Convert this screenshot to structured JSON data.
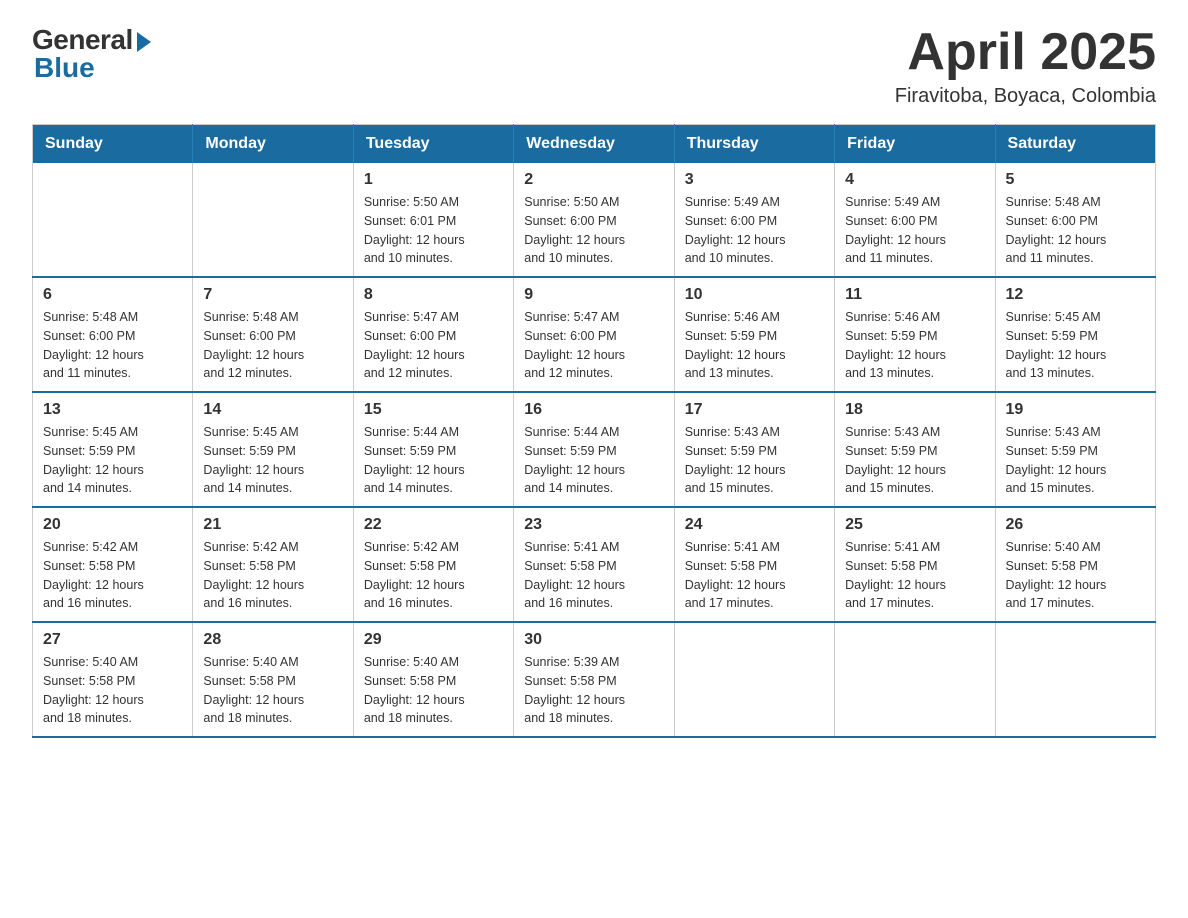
{
  "logo": {
    "general": "General",
    "blue": "Blue"
  },
  "title": {
    "month_year": "April 2025",
    "location": "Firavitoba, Boyaca, Colombia"
  },
  "headers": [
    "Sunday",
    "Monday",
    "Tuesday",
    "Wednesday",
    "Thursday",
    "Friday",
    "Saturday"
  ],
  "weeks": [
    [
      {
        "day": "",
        "info": ""
      },
      {
        "day": "",
        "info": ""
      },
      {
        "day": "1",
        "info": "Sunrise: 5:50 AM\nSunset: 6:01 PM\nDaylight: 12 hours\nand 10 minutes."
      },
      {
        "day": "2",
        "info": "Sunrise: 5:50 AM\nSunset: 6:00 PM\nDaylight: 12 hours\nand 10 minutes."
      },
      {
        "day": "3",
        "info": "Sunrise: 5:49 AM\nSunset: 6:00 PM\nDaylight: 12 hours\nand 10 minutes."
      },
      {
        "day": "4",
        "info": "Sunrise: 5:49 AM\nSunset: 6:00 PM\nDaylight: 12 hours\nand 11 minutes."
      },
      {
        "day": "5",
        "info": "Sunrise: 5:48 AM\nSunset: 6:00 PM\nDaylight: 12 hours\nand 11 minutes."
      }
    ],
    [
      {
        "day": "6",
        "info": "Sunrise: 5:48 AM\nSunset: 6:00 PM\nDaylight: 12 hours\nand 11 minutes."
      },
      {
        "day": "7",
        "info": "Sunrise: 5:48 AM\nSunset: 6:00 PM\nDaylight: 12 hours\nand 12 minutes."
      },
      {
        "day": "8",
        "info": "Sunrise: 5:47 AM\nSunset: 6:00 PM\nDaylight: 12 hours\nand 12 minutes."
      },
      {
        "day": "9",
        "info": "Sunrise: 5:47 AM\nSunset: 6:00 PM\nDaylight: 12 hours\nand 12 minutes."
      },
      {
        "day": "10",
        "info": "Sunrise: 5:46 AM\nSunset: 5:59 PM\nDaylight: 12 hours\nand 13 minutes."
      },
      {
        "day": "11",
        "info": "Sunrise: 5:46 AM\nSunset: 5:59 PM\nDaylight: 12 hours\nand 13 minutes."
      },
      {
        "day": "12",
        "info": "Sunrise: 5:45 AM\nSunset: 5:59 PM\nDaylight: 12 hours\nand 13 minutes."
      }
    ],
    [
      {
        "day": "13",
        "info": "Sunrise: 5:45 AM\nSunset: 5:59 PM\nDaylight: 12 hours\nand 14 minutes."
      },
      {
        "day": "14",
        "info": "Sunrise: 5:45 AM\nSunset: 5:59 PM\nDaylight: 12 hours\nand 14 minutes."
      },
      {
        "day": "15",
        "info": "Sunrise: 5:44 AM\nSunset: 5:59 PM\nDaylight: 12 hours\nand 14 minutes."
      },
      {
        "day": "16",
        "info": "Sunrise: 5:44 AM\nSunset: 5:59 PM\nDaylight: 12 hours\nand 14 minutes."
      },
      {
        "day": "17",
        "info": "Sunrise: 5:43 AM\nSunset: 5:59 PM\nDaylight: 12 hours\nand 15 minutes."
      },
      {
        "day": "18",
        "info": "Sunrise: 5:43 AM\nSunset: 5:59 PM\nDaylight: 12 hours\nand 15 minutes."
      },
      {
        "day": "19",
        "info": "Sunrise: 5:43 AM\nSunset: 5:59 PM\nDaylight: 12 hours\nand 15 minutes."
      }
    ],
    [
      {
        "day": "20",
        "info": "Sunrise: 5:42 AM\nSunset: 5:58 PM\nDaylight: 12 hours\nand 16 minutes."
      },
      {
        "day": "21",
        "info": "Sunrise: 5:42 AM\nSunset: 5:58 PM\nDaylight: 12 hours\nand 16 minutes."
      },
      {
        "day": "22",
        "info": "Sunrise: 5:42 AM\nSunset: 5:58 PM\nDaylight: 12 hours\nand 16 minutes."
      },
      {
        "day": "23",
        "info": "Sunrise: 5:41 AM\nSunset: 5:58 PM\nDaylight: 12 hours\nand 16 minutes."
      },
      {
        "day": "24",
        "info": "Sunrise: 5:41 AM\nSunset: 5:58 PM\nDaylight: 12 hours\nand 17 minutes."
      },
      {
        "day": "25",
        "info": "Sunrise: 5:41 AM\nSunset: 5:58 PM\nDaylight: 12 hours\nand 17 minutes."
      },
      {
        "day": "26",
        "info": "Sunrise: 5:40 AM\nSunset: 5:58 PM\nDaylight: 12 hours\nand 17 minutes."
      }
    ],
    [
      {
        "day": "27",
        "info": "Sunrise: 5:40 AM\nSunset: 5:58 PM\nDaylight: 12 hours\nand 18 minutes."
      },
      {
        "day": "28",
        "info": "Sunrise: 5:40 AM\nSunset: 5:58 PM\nDaylight: 12 hours\nand 18 minutes."
      },
      {
        "day": "29",
        "info": "Sunrise: 5:40 AM\nSunset: 5:58 PM\nDaylight: 12 hours\nand 18 minutes."
      },
      {
        "day": "30",
        "info": "Sunrise: 5:39 AM\nSunset: 5:58 PM\nDaylight: 12 hours\nand 18 minutes."
      },
      {
        "day": "",
        "info": ""
      },
      {
        "day": "",
        "info": ""
      },
      {
        "day": "",
        "info": ""
      }
    ]
  ]
}
